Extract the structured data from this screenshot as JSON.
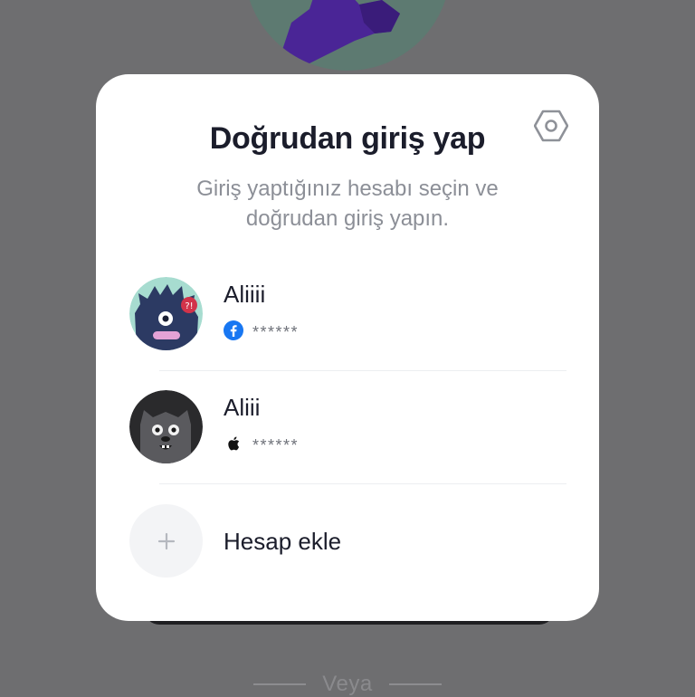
{
  "background": {
    "divider_text": "Veya"
  },
  "modal": {
    "title": "Doğrudan giriş yap",
    "subtitle": "Giriş yaptığınız hesabı seçin ve doğrudan giriş yapın.",
    "settings_icon": "hexagon-settings-icon",
    "accounts": [
      {
        "name": "Aliiii",
        "method_icon": "facebook-icon",
        "password_mask": "******"
      },
      {
        "name": "Aliii",
        "method_icon": "apple-icon",
        "password_mask": "******"
      }
    ],
    "add_account_label": "Hesap ekle",
    "add_icon": "plus-icon"
  },
  "colors": {
    "overlay": "#6e6e70",
    "title": "#1b1d2b",
    "subtitle": "#8c8f97",
    "facebook": "#1877f2"
  }
}
